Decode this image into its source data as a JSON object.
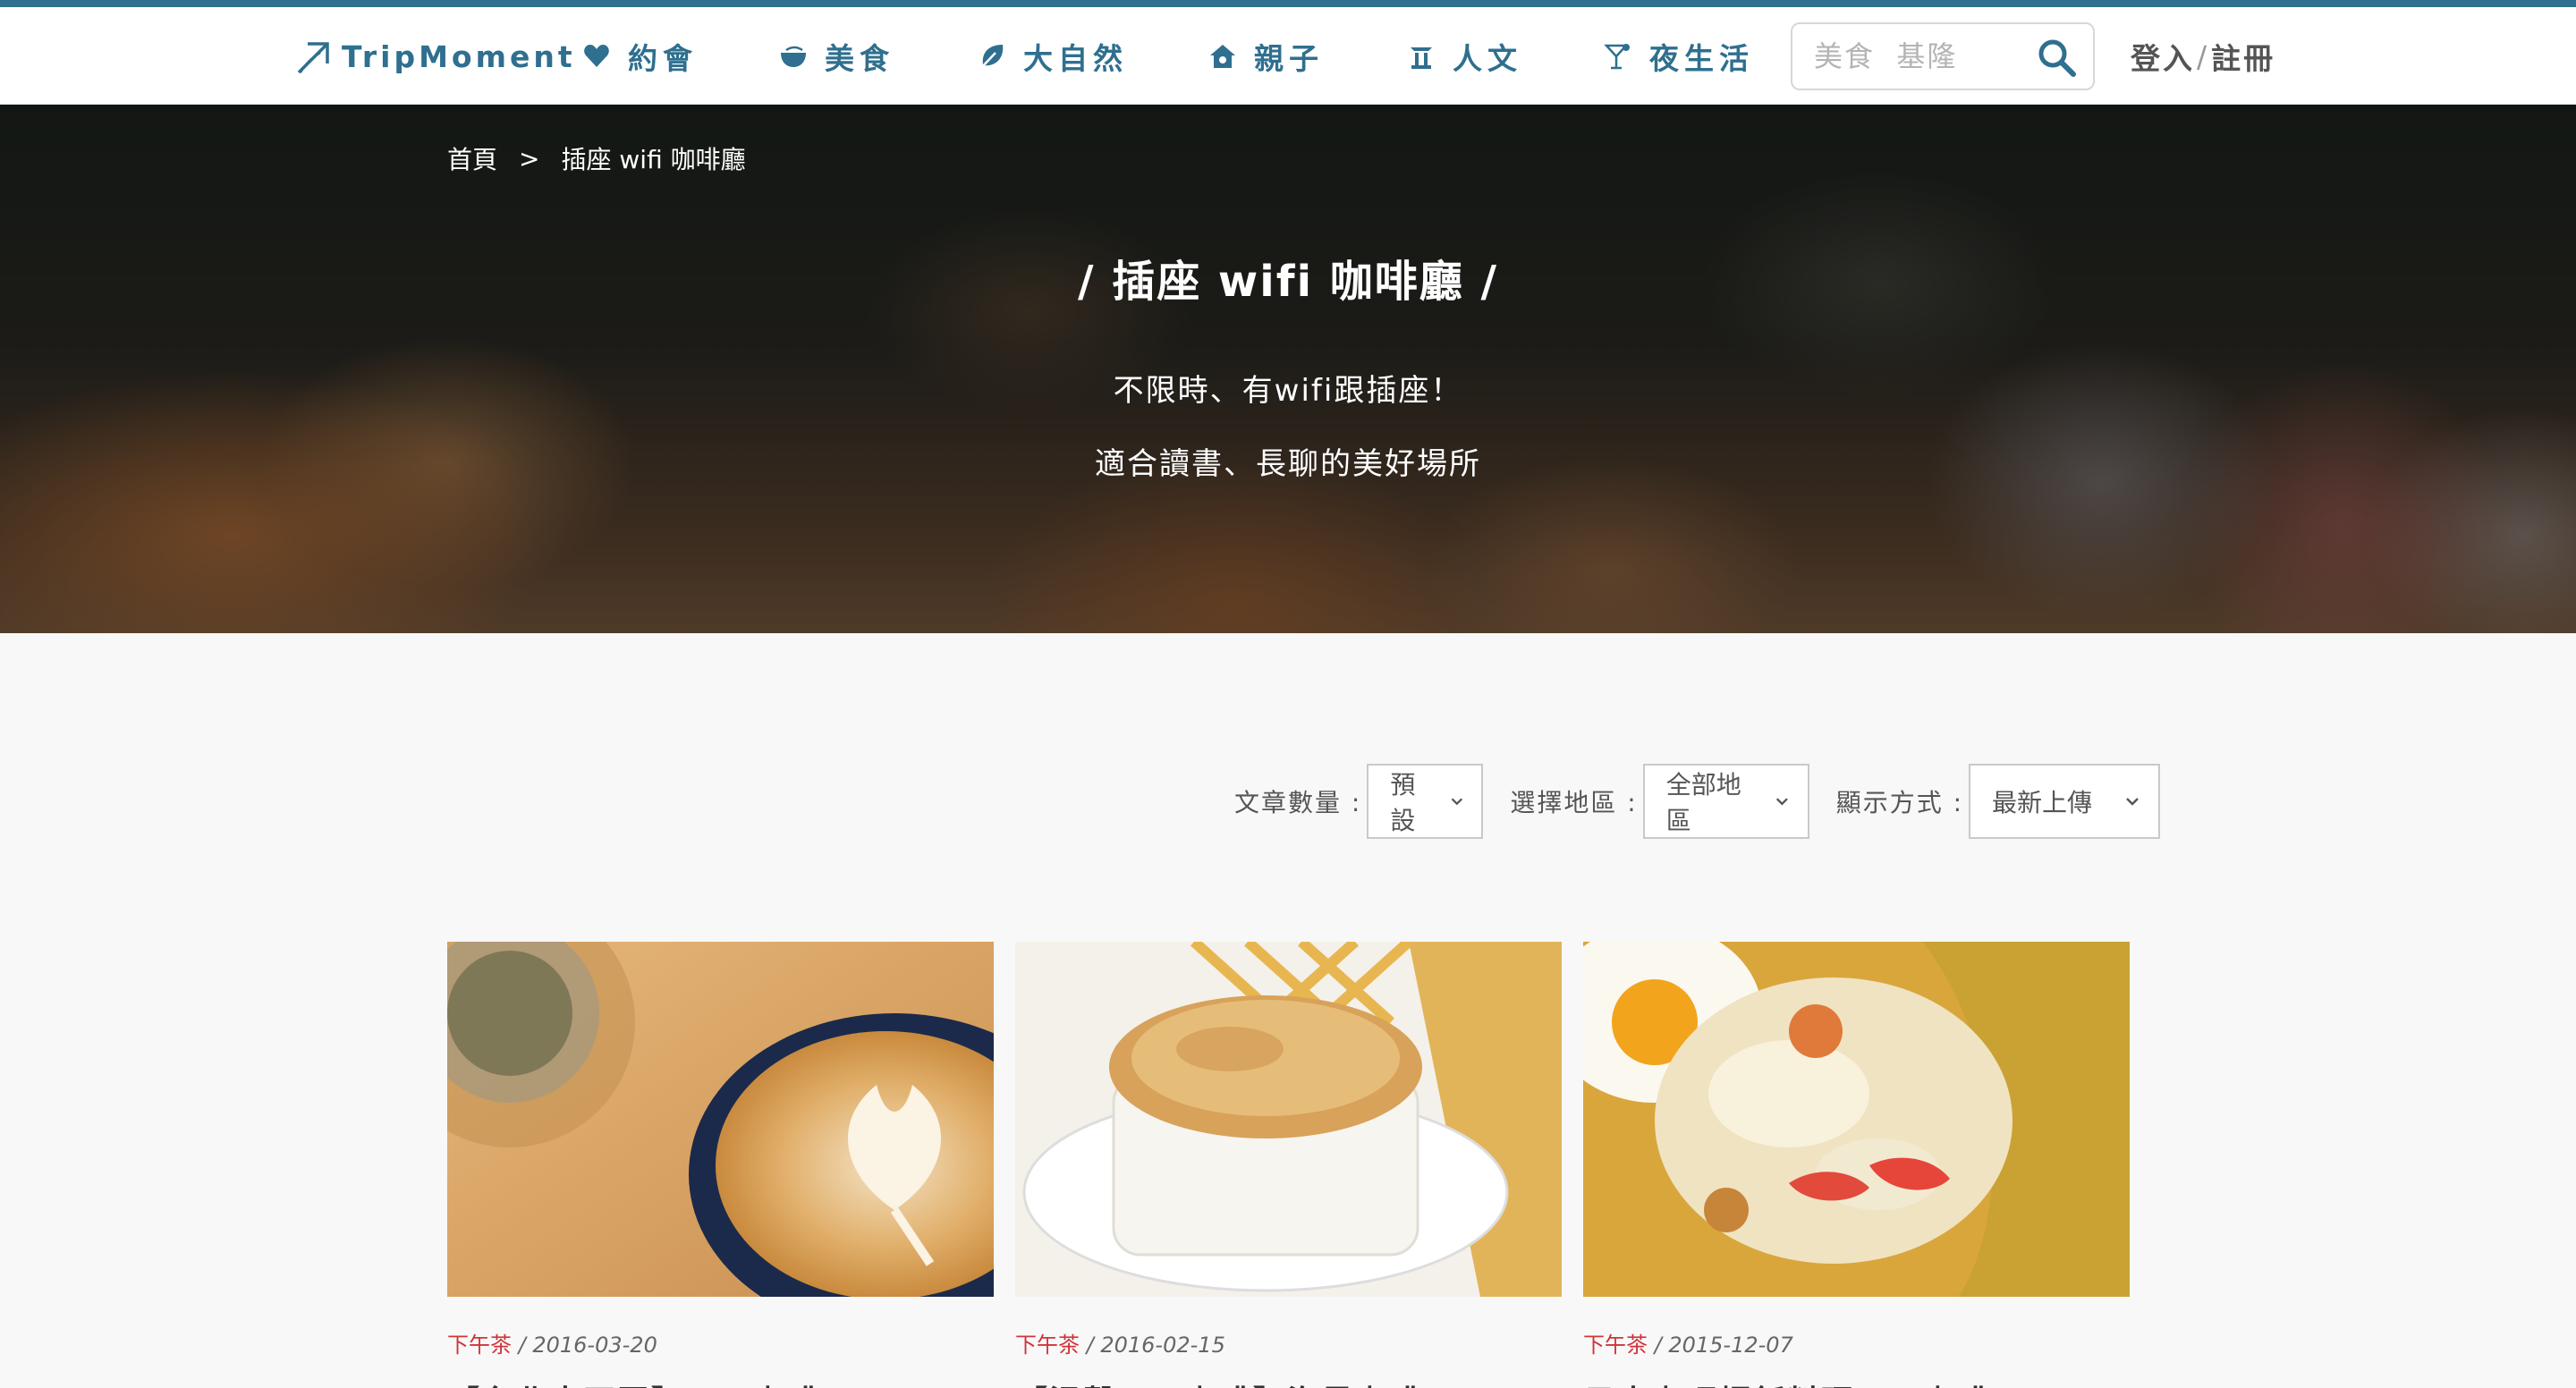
{
  "brand": {
    "name": "TripMoment",
    "color": "#2f6f8f"
  },
  "nav": {
    "items": [
      {
        "label": "約會",
        "icon": "heart-icon"
      },
      {
        "label": "美食",
        "icon": "bowl-icon"
      },
      {
        "label": "大自然",
        "icon": "leaf-icon"
      },
      {
        "label": "親子",
        "icon": "house-icon"
      },
      {
        "label": "人文",
        "icon": "temple-icon"
      },
      {
        "label": "夜生活",
        "icon": "cocktail-icon"
      }
    ],
    "search_placeholder": "美食  基隆",
    "login_label": "登入",
    "auth_separator": "/",
    "register_label": "註冊"
  },
  "hero": {
    "breadcrumb": {
      "home": "首頁",
      "separator": ">",
      "current": "插座 wifi 咖啡廳"
    },
    "title": "/ 插座 wifi 咖啡廳 /",
    "description_lines": [
      "不限時、有wifi跟插座！",
      "適合讀書、長聊的美好場所"
    ]
  },
  "filters": {
    "count": {
      "label": "文章數量 :",
      "value": "預設"
    },
    "region": {
      "label": "選擇地區 :",
      "value": "全部地區"
    },
    "sort": {
      "label": "顯示方式 :",
      "value": "最新上傳"
    }
  },
  "articles": [
    {
      "category": "下午茶",
      "date": "/ 2016-03-20",
      "title": "【台北中正區】ＸＸ咖啡",
      "image": "latte-art-photo"
    },
    {
      "category": "下午茶",
      "date": "/ 2016-02-15",
      "title": "【溫馨ＸＸ咖啡】海景咖啡",
      "image": "pot-pie-photo"
    },
    {
      "category": "下午茶",
      "date": "/ 2015-12-07",
      "title": "日本咖哩焗飯料理ＸＸ咖啡",
      "image": "curry-rice-photo"
    }
  ],
  "colors": {
    "accent": "#2f6f8f",
    "category": "#d0343a",
    "background": "#f8f8f8"
  }
}
